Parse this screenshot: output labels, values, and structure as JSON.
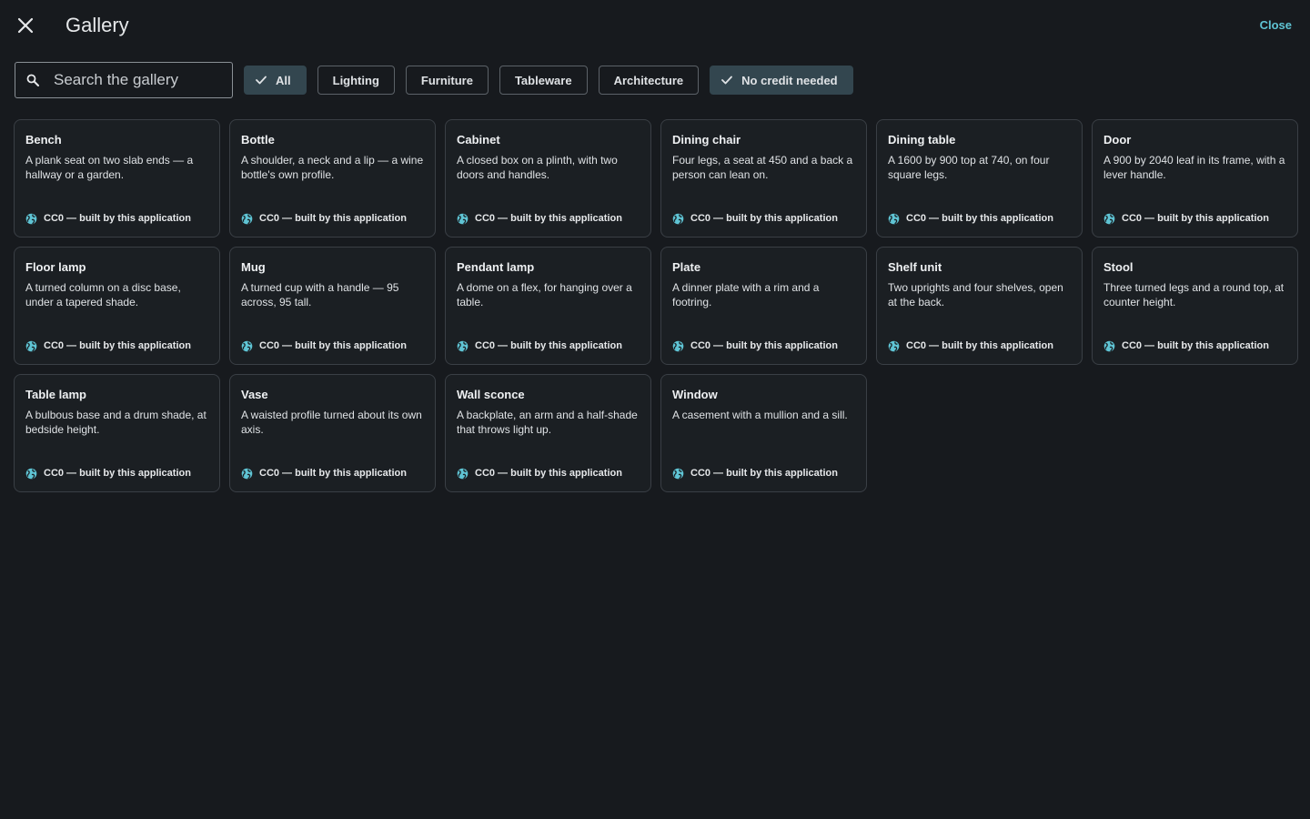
{
  "header": {
    "title": "Gallery",
    "close_label": "Close"
  },
  "search": {
    "placeholder": "Search the gallery",
    "value": ""
  },
  "filters": [
    {
      "label": "All",
      "selected": true
    },
    {
      "label": "Lighting",
      "selected": false
    },
    {
      "label": "Furniture",
      "selected": false
    },
    {
      "label": "Tableware",
      "selected": false
    },
    {
      "label": "Architecture",
      "selected": false
    },
    {
      "label": "No credit needed",
      "selected": true
    }
  ],
  "items": [
    {
      "title": "Bench",
      "description": "A plank seat on two slab ends — a hallway or a garden.",
      "license": "CC0 — built by this application"
    },
    {
      "title": "Bottle",
      "description": "A shoulder, a neck and a lip — a wine bottle's own profile.",
      "license": "CC0 — built by this application"
    },
    {
      "title": "Cabinet",
      "description": "A closed box on a plinth, with two doors and handles.",
      "license": "CC0 — built by this application"
    },
    {
      "title": "Dining chair",
      "description": "Four legs, a seat at 450 and a back a person can lean on.",
      "license": "CC0 — built by this application"
    },
    {
      "title": "Dining table",
      "description": "A 1600 by 900 top at 740, on four square legs.",
      "license": "CC0 — built by this application"
    },
    {
      "title": "Door",
      "description": "A 900 by 2040 leaf in its frame, with a lever handle.",
      "license": "CC0 — built by this application"
    },
    {
      "title": "Floor lamp",
      "description": "A turned column on a disc base, under a tapered shade.",
      "license": "CC0 — built by this application"
    },
    {
      "title": "Mug",
      "description": "A turned cup with a handle — 95 across, 95 tall.",
      "license": "CC0 — built by this application"
    },
    {
      "title": "Pendant lamp",
      "description": "A dome on a flex, for hanging over a table.",
      "license": "CC0 — built by this application"
    },
    {
      "title": "Plate",
      "description": "A dinner plate with a rim and a footring.",
      "license": "CC0 — built by this application"
    },
    {
      "title": "Shelf unit",
      "description": "Two uprights and four shelves, open at the back.",
      "license": "CC0 — built by this application"
    },
    {
      "title": "Stool",
      "description": "Three turned legs and a round top, at counter height.",
      "license": "CC0 — built by this application"
    },
    {
      "title": "Table lamp",
      "description": "A bulbous base and a drum shade, at bedside height.",
      "license": "CC0 — built by this application"
    },
    {
      "title": "Vase",
      "description": "A waisted profile turned about its own axis.",
      "license": "CC0 — built by this application"
    },
    {
      "title": "Wall sconce",
      "description": "A backplate, an arm and a half-shade that throws light up.",
      "license": "CC0 — built by this application"
    },
    {
      "title": "Window",
      "description": "A casement with a mullion and a sill.",
      "license": "CC0 — built by this application"
    }
  ],
  "icons": {
    "close": "close-icon",
    "search": "search-icon",
    "check": "check-icon",
    "license": "globe-icon"
  },
  "colors": {
    "background": "#171a1e",
    "accent": "#5fc4d4",
    "selected_chip": "#33464f",
    "card_border": "#3a3f45"
  }
}
